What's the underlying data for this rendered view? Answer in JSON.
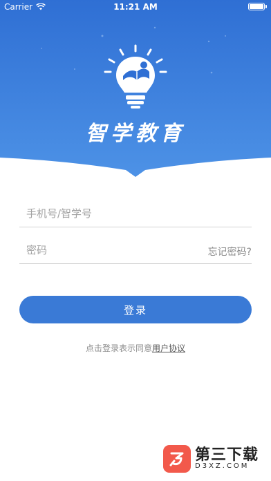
{
  "status_bar": {
    "carrier": "Carrier",
    "time": "11:21 AM"
  },
  "app": {
    "title": "智学教育"
  },
  "form": {
    "phone_placeholder": "手机号/智学号",
    "password_placeholder": "密码",
    "forgot_password": "忘记密码?",
    "login_button": "登录"
  },
  "agreement": {
    "prefix": "点击登录表示同意",
    "link": "用户协议"
  },
  "watermark": {
    "main": "第三下载",
    "sub": "D3XZ.COM"
  },
  "colors": {
    "header_top": "#2f6fd4",
    "header_bottom": "#4d92e6",
    "button": "#3a7ad6",
    "watermark_logo": "#f2594b"
  },
  "icons": {
    "logo": "lightbulb-with-book-icon",
    "wifi": "wifi-icon",
    "battery": "battery-icon"
  }
}
